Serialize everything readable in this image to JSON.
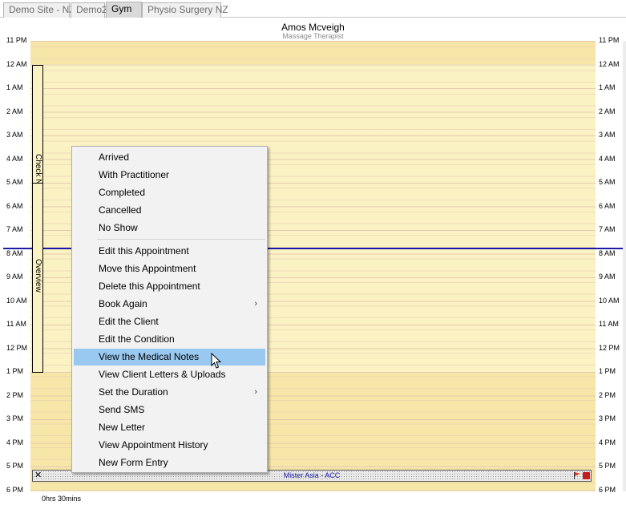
{
  "tabs": [
    {
      "label": "Demo Site - NZ",
      "active": false
    },
    {
      "label": "Demo2",
      "active": false
    },
    {
      "label": "Gym",
      "active": true
    },
    {
      "label": "Physio Surgery NZ",
      "active": false
    }
  ],
  "practitioner": {
    "name": "Amos Mcveigh",
    "role": "Massage Therapist"
  },
  "times": [
    "11 PM",
    "12 AM",
    "1 AM",
    "2 AM",
    "3 AM",
    "4 AM",
    "5 AM",
    "6 AM",
    "7 AM",
    "8 AM",
    "9 AM",
    "10 AM",
    "11 AM",
    "12 PM",
    "1 PM",
    "2 PM",
    "3 PM",
    "4 PM",
    "5 PM",
    "6 PM"
  ],
  "blocks": {
    "check_label": "Check NZ",
    "overview_label": "Overview"
  },
  "appointment": {
    "close_glyph": "✕",
    "label": "Mister Asia - ACC",
    "flag_colors": [
      "#e03c1e",
      "#c41e1e"
    ]
  },
  "duration": "0hrs 30mins",
  "context_menu": {
    "status_items": [
      "Arrived",
      "With Practitioner",
      "Completed",
      "Cancelled",
      "No Show"
    ],
    "action_items": [
      {
        "label": "Edit this Appointment",
        "submenu": false
      },
      {
        "label": "Move this Appointment",
        "submenu": false
      },
      {
        "label": "Delete this Appointment",
        "submenu": false
      },
      {
        "label": "Book Again",
        "submenu": true
      },
      {
        "label": "Edit the Client",
        "submenu": false
      },
      {
        "label": "Edit the Condition",
        "submenu": false
      },
      {
        "label": "View the Medical Notes",
        "submenu": false,
        "highlighted": true
      },
      {
        "label": "View Client Letters & Uploads",
        "submenu": false
      },
      {
        "label": "Set the Duration",
        "submenu": true
      },
      {
        "label": "Send SMS",
        "submenu": false
      },
      {
        "label": "New Letter",
        "submenu": false
      },
      {
        "label": "View Appointment History",
        "submenu": false
      },
      {
        "label": "New Form Entry",
        "submenu": false
      }
    ],
    "submenu_glyph": "›"
  },
  "colors": {
    "now_line": "#1a1aa6",
    "grid_bg": "#fbf2c4",
    "menu_highlight": "#99c9f0"
  }
}
